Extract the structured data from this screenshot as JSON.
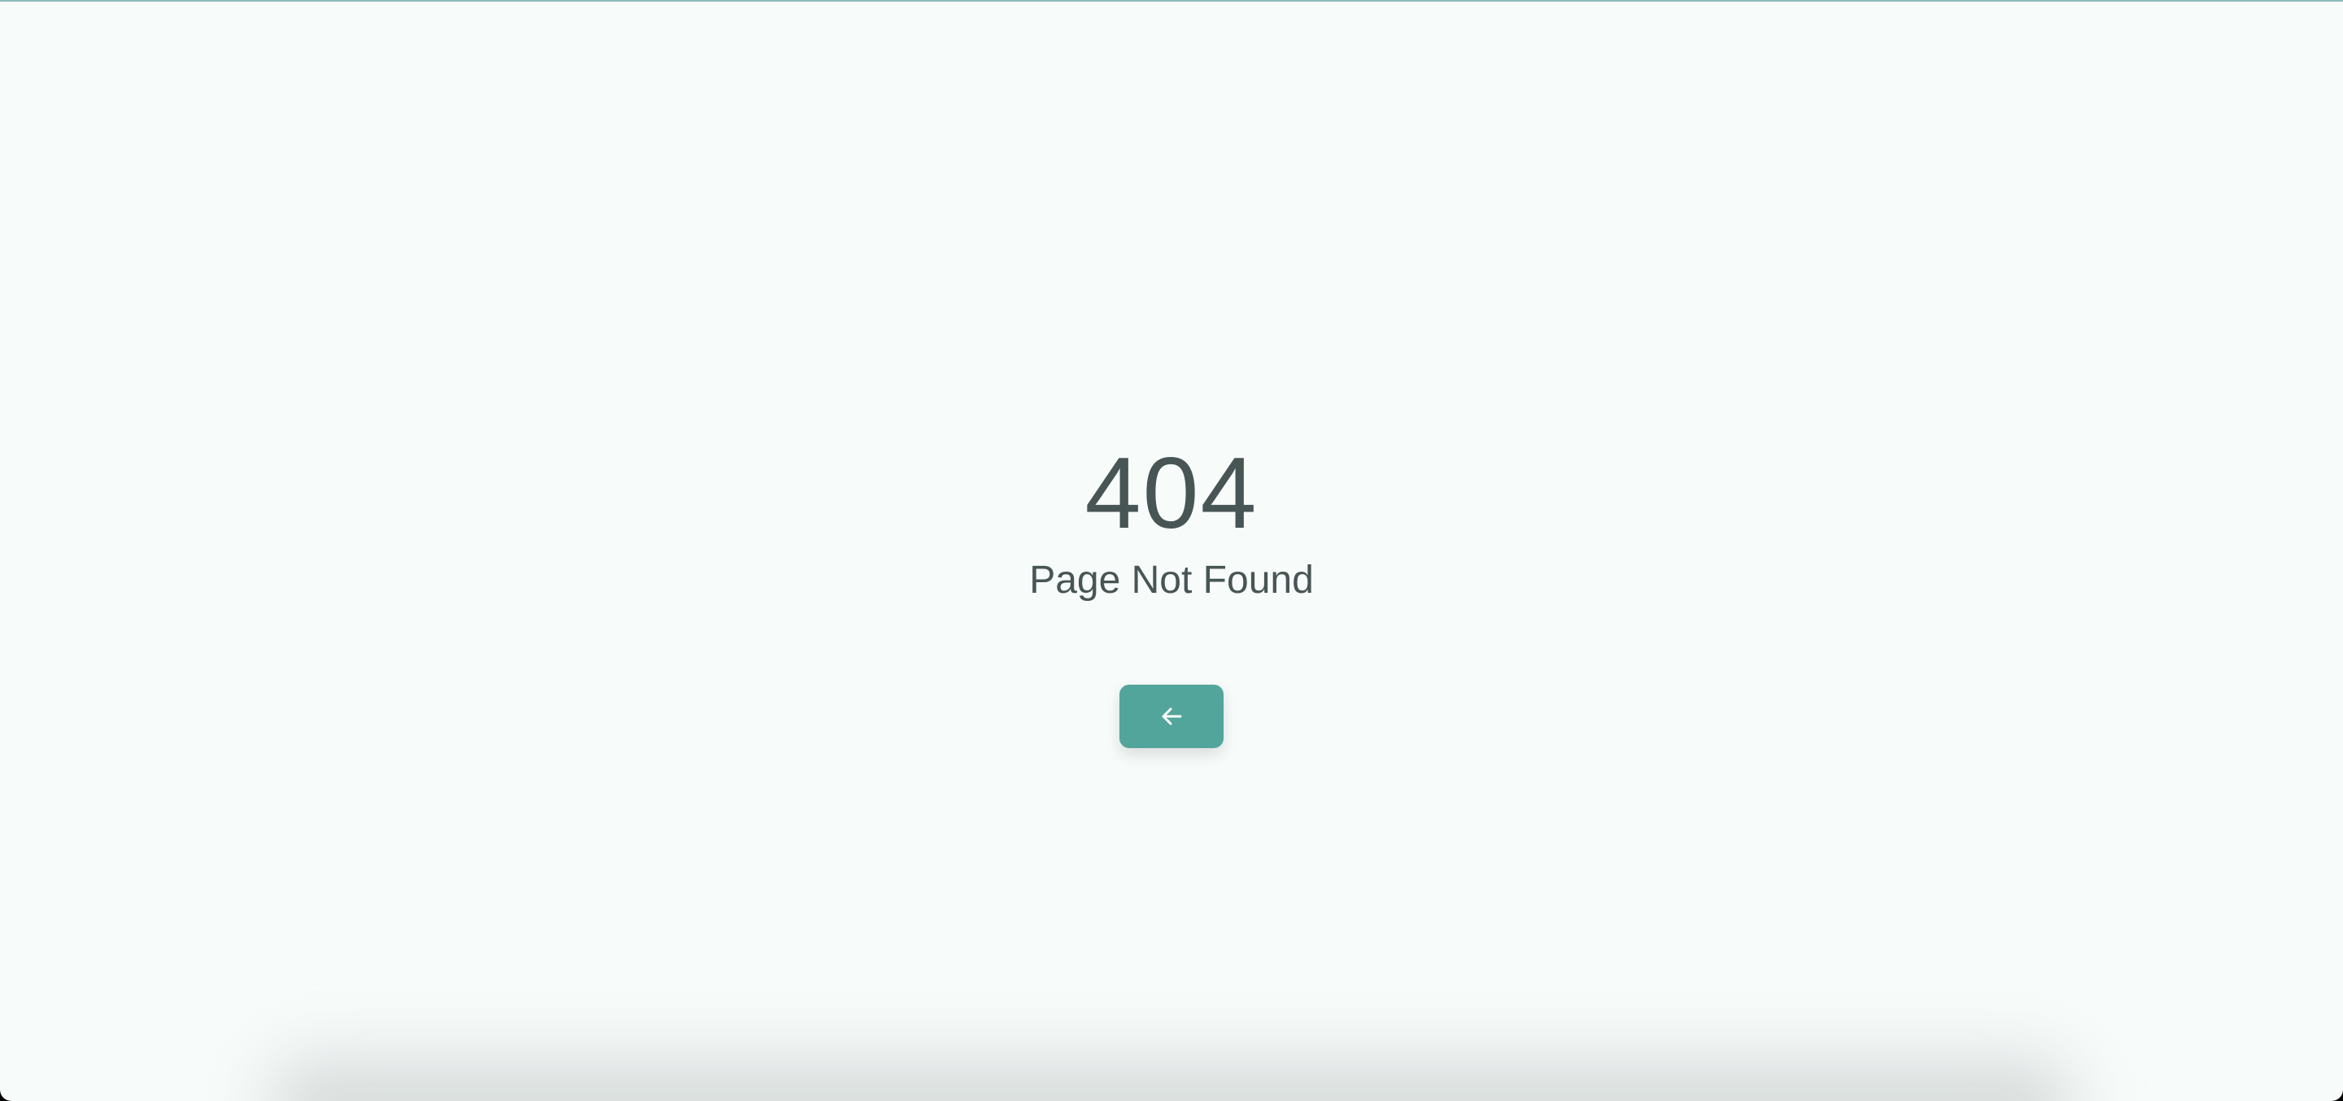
{
  "error": {
    "code": "404",
    "message": "Page Not Found"
  },
  "back_button": {
    "icon": "arrow-left-icon",
    "color": "#52a59a"
  },
  "colors": {
    "background": "#f7fbfa",
    "text": "#485555",
    "accent": "#52a59a"
  }
}
